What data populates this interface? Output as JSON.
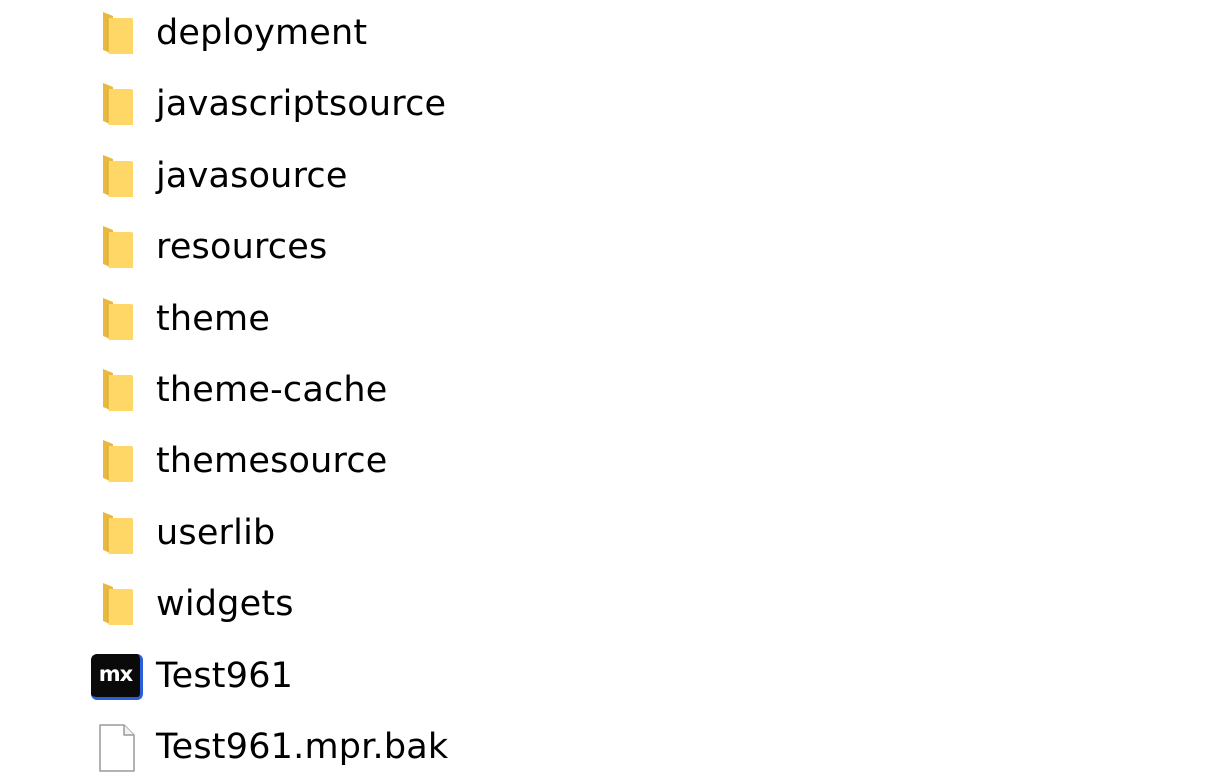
{
  "colors": {
    "folder_front": "#FFD766",
    "folder_back": "#E8B93E",
    "text": "#000000",
    "mx_badge_bg": "#0A0A0A",
    "mx_badge_accent": "#2B5FD9"
  },
  "items": [
    {
      "name": "deployment",
      "icon": "folder-icon"
    },
    {
      "name": "javascriptsource",
      "icon": "folder-icon"
    },
    {
      "name": "javasource",
      "icon": "folder-icon"
    },
    {
      "name": "resources",
      "icon": "folder-icon"
    },
    {
      "name": "theme",
      "icon": "folder-icon"
    },
    {
      "name": "theme-cache",
      "icon": "folder-icon"
    },
    {
      "name": "themesource",
      "icon": "folder-icon"
    },
    {
      "name": "userlib",
      "icon": "folder-icon"
    },
    {
      "name": "widgets",
      "icon": "folder-icon"
    },
    {
      "name": "Test961",
      "icon": "mendix-project-icon",
      "badge_text": "mx"
    },
    {
      "name": "Test961.mpr.bak",
      "icon": "generic-file-icon"
    }
  ]
}
